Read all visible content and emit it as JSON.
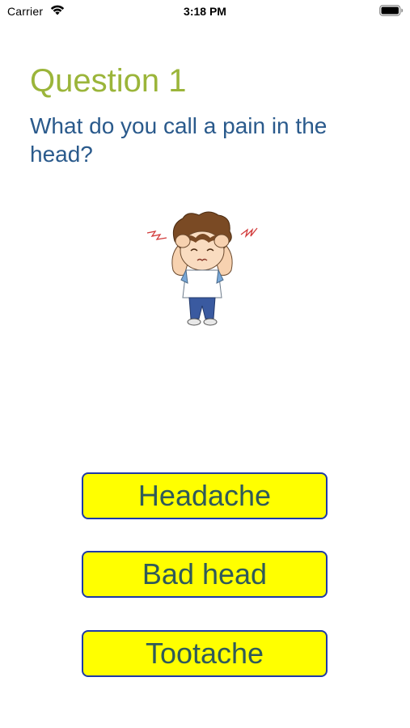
{
  "status_bar": {
    "carrier": "Carrier",
    "time": "3:18 PM"
  },
  "quiz": {
    "question_number": "Question 1",
    "question_text": "What do you call a pain in the head?",
    "illustration": "boy-with-headache-icon",
    "answers": [
      {
        "label": "Headache"
      },
      {
        "label": "Bad head"
      },
      {
        "label": "Tootache"
      }
    ]
  },
  "colors": {
    "question_number": "#9bb53a",
    "question_text": "#2a5a8c",
    "button_fill": "#ffff00",
    "button_border": "#1e3aa8",
    "button_text": "#2f5a5a"
  }
}
